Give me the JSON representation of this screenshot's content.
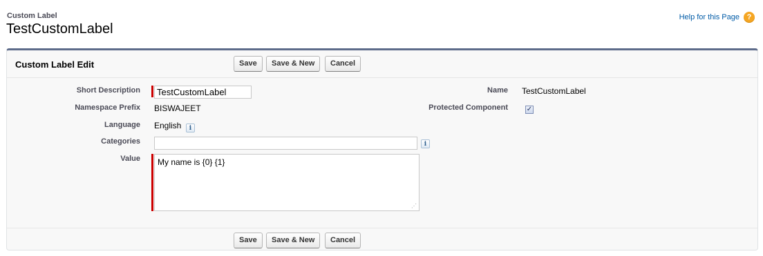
{
  "page_header": {
    "object_type": "Custom Label",
    "record_name": "TestCustomLabel",
    "help_link": "Help for this Page",
    "help_icon": "question-mark-icon"
  },
  "edit_block": {
    "title": "Custom Label Edit",
    "buttons": {
      "save": "Save",
      "save_new": "Save & New",
      "cancel": "Cancel"
    }
  },
  "fields": {
    "short_description": {
      "label": "Short Description",
      "value": "TestCustomLabel",
      "required": true
    },
    "namespace_prefix": {
      "label": "Namespace Prefix",
      "value": "BISWAJEET"
    },
    "language": {
      "label": "Language",
      "value": "English",
      "info_icon": "info-icon"
    },
    "categories": {
      "label": "Categories",
      "value": "",
      "info_icon": "info-icon"
    },
    "value": {
      "label": "Value",
      "value": "My name is {0} {1}",
      "required": true
    },
    "name": {
      "label": "Name",
      "value": "TestCustomLabel"
    },
    "protected_component": {
      "label": "Protected Component",
      "checked": true
    }
  },
  "colors": {
    "required_bar": "#cc0000",
    "block_top_border": "#5d6b8a",
    "link": "#015ba7",
    "help_icon": "#f5a623"
  }
}
